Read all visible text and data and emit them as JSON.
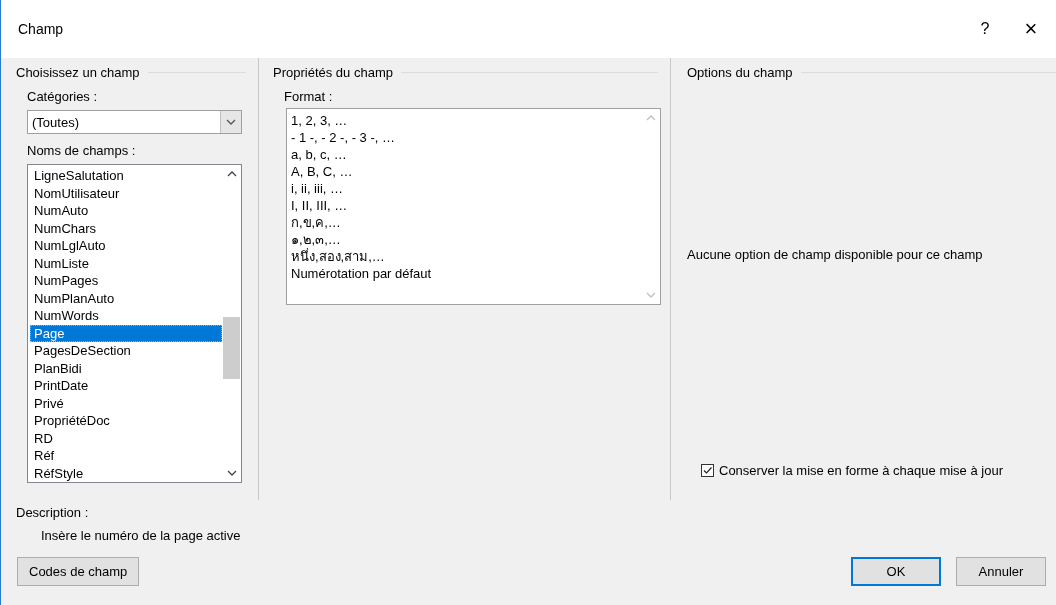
{
  "window": {
    "title": "Champ",
    "help": "?",
    "close": "×"
  },
  "choose_field": {
    "title": "Choisissez un champ",
    "categories": {
      "label": "Catégories :",
      "value": "(Toutes)"
    },
    "field_names": {
      "label": "Noms de champs :",
      "items": [
        {
          "label": "LigneSalutation",
          "selected": false
        },
        {
          "label": "NomUtilisateur",
          "selected": false
        },
        {
          "label": "NumAuto",
          "selected": false
        },
        {
          "label": "NumChars",
          "selected": false
        },
        {
          "label": "NumLglAuto",
          "selected": false
        },
        {
          "label": "NumListe",
          "selected": false
        },
        {
          "label": "NumPages",
          "selected": false
        },
        {
          "label": "NumPlanAuto",
          "selected": false
        },
        {
          "label": "NumWords",
          "selected": false
        },
        {
          "label": "Page",
          "selected": true
        },
        {
          "label": "PagesDeSection",
          "selected": false
        },
        {
          "label": "PlanBidi",
          "selected": false
        },
        {
          "label": "PrintDate",
          "selected": false
        },
        {
          "label": "Privé",
          "selected": false
        },
        {
          "label": "PropriétéDoc",
          "selected": false
        },
        {
          "label": "RD",
          "selected": false
        },
        {
          "label": "Réf",
          "selected": false
        },
        {
          "label": "RéfStyle",
          "selected": false
        }
      ]
    }
  },
  "field_properties": {
    "title": "Propriétés du champ",
    "format": {
      "label": "Format :",
      "items": [
        "1, 2, 3, …",
        "- 1 -, - 2 -, - 3 -, …",
        "a, b, c, …",
        "A, B, C, …",
        "i, ii, iii, …",
        "I, II, III, …",
        "ก,ข,ค,…",
        "๑,๒,๓,…",
        "หนึ่ง,สอง,สาม,…",
        "Numérotation par défaut"
      ]
    }
  },
  "field_options": {
    "title": "Options du champ",
    "message": "Aucune option de champ disponible pour ce champ",
    "preserve_formatting": {
      "label": "Conserver la mise en forme à chaque mise à jour",
      "checked": true
    }
  },
  "description": {
    "label": "Description :",
    "text": "Insère le numéro de la page active"
  },
  "field_codes_button": "Codes de champ",
  "dialog_buttons": [
    {
      "label": "OK",
      "default": true
    },
    {
      "label": "Annuler",
      "default": false
    }
  ]
}
